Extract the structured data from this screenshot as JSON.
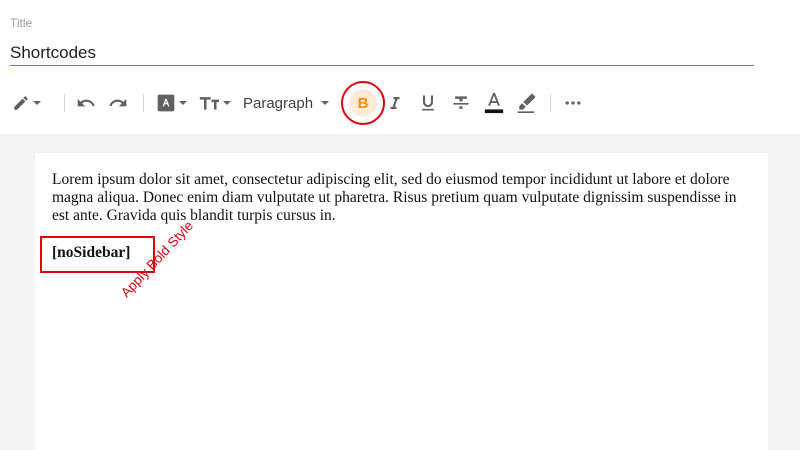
{
  "title_field": {
    "label": "Title",
    "value": "Shortcodes"
  },
  "toolbar": {
    "items": [
      {
        "icon": "pencil-icon",
        "has_dropdown": true
      },
      {
        "icon": "undo-icon"
      },
      {
        "icon": "redo-icon"
      },
      {
        "icon": "font-icon",
        "has_dropdown": true
      },
      {
        "icon": "text-size-icon",
        "has_dropdown": true
      },
      {
        "icon": "bold-icon"
      },
      {
        "icon": "italic-icon"
      },
      {
        "icon": "underline-icon"
      },
      {
        "icon": "strikethrough-icon"
      },
      {
        "icon": "text-color-icon"
      },
      {
        "icon": "highlight-icon"
      },
      {
        "icon": "more-icon"
      }
    ],
    "paragraph_label": "Paragraph",
    "bold_label": "B",
    "active_color": "#f28c13",
    "highlight_circle_color": "#e3000f"
  },
  "editor": {
    "paragraph": "Lorem ipsum dolor sit amet, consectetur adipiscing elit, sed do eiusmod tempor incididunt ut labore et dolore magna aliqua. Donec enim diam vulputate ut pharetra. Risus pretium quam vulputate dignissim suspendisse in est ante. Gravida quis blandit turpis cursus in.",
    "shortcode": "[noSidebar]"
  },
  "annotation": {
    "text": "Apply Bold Style",
    "color": "#e3000f"
  }
}
